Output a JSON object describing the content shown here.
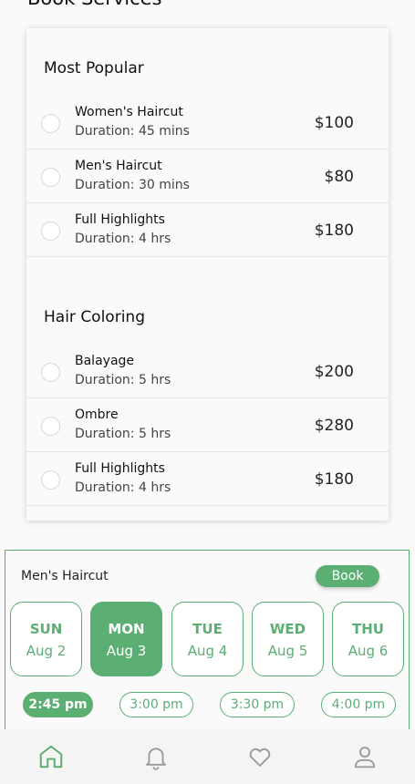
{
  "page": {
    "title": "Book Services"
  },
  "sections": [
    {
      "title": "Most Popular",
      "services": [
        {
          "name": "Women's Haircut",
          "duration": "Duration: 45 mins",
          "price": "$100"
        },
        {
          "name": "Men's Haircut",
          "duration": "Duration: 30 mins",
          "price": "$80"
        },
        {
          "name": "Full Highlights",
          "duration": "Duration: 4 hrs",
          "price": "$180"
        }
      ]
    },
    {
      "title": "Hair Coloring",
      "services": [
        {
          "name": "Balayage",
          "duration": "Duration: 5 hrs",
          "price": "$200"
        },
        {
          "name": "Ombre",
          "duration": "Duration: 5 hrs",
          "price": "$280"
        },
        {
          "name": "Full Highlights",
          "duration": "Duration: 4 hrs",
          "price": "$180"
        }
      ]
    }
  ],
  "booking": {
    "service": "Men's Haircut",
    "book_label": "Book",
    "days": [
      {
        "dow": "SUN",
        "date": "Aug 2",
        "selected": false
      },
      {
        "dow": "MON",
        "date": "Aug 3",
        "selected": true
      },
      {
        "dow": "TUE",
        "date": "Aug 4",
        "selected": false
      },
      {
        "dow": "WED",
        "date": "Aug 5",
        "selected": false
      },
      {
        "dow": "THU",
        "date": "Aug 6",
        "selected": false
      }
    ],
    "times": [
      {
        "label": "2:45 pm",
        "selected": true
      },
      {
        "label": "3:00 pm",
        "selected": false
      },
      {
        "label": "3:30 pm",
        "selected": false
      },
      {
        "label": "4:00 pm",
        "selected": false
      }
    ]
  },
  "nav": {
    "items": [
      {
        "icon": "home-icon",
        "active": true
      },
      {
        "icon": "bell-icon",
        "active": false
      },
      {
        "icon": "heart-icon",
        "active": false
      },
      {
        "icon": "user-icon",
        "active": false
      }
    ]
  },
  "colors": {
    "accent": "#5caf73",
    "inactive_icon": "#9a9a9a"
  }
}
